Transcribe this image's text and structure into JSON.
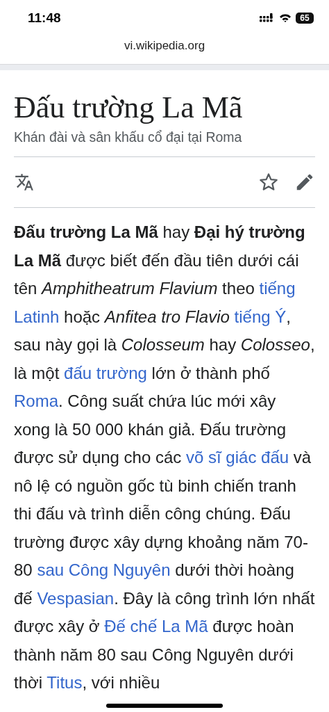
{
  "status_bar": {
    "time": "11:48",
    "battery": "65"
  },
  "address_bar": {
    "url": "vi.wikipedia.org"
  },
  "article": {
    "title": "Đấu trường La Mã",
    "subtitle": "Khán đài và sân khấu cổ đại tại Roma",
    "paragraph": [
      {
        "kind": "bold",
        "text": "Đấu trường La Mã"
      },
      {
        "kind": "plain",
        "text": " hay "
      },
      {
        "kind": "bold",
        "text": "Đại hý trường La Mã"
      },
      {
        "kind": "plain",
        "text": " được biết đến đầu tiên dưới cái tên "
      },
      {
        "kind": "italic",
        "text": "Amphitheatrum Flavium"
      },
      {
        "kind": "plain",
        "text": " theo "
      },
      {
        "kind": "link",
        "text": "tiếng"
      },
      {
        "kind": "link",
        "text": "Latinh"
      },
      {
        "kind": "plain",
        "text": " hoặc "
      },
      {
        "kind": "italic",
        "text": "Anfitea tro Flavio"
      },
      {
        "kind": "link",
        "text": "tiếng Ý"
      },
      {
        "kind": "plain",
        "text": ", sau này gọi là "
      },
      {
        "kind": "italic",
        "text": "Colosseum"
      },
      {
        "kind": "plain",
        "text": " hay "
      },
      {
        "kind": "italic",
        "text": "Colosseo"
      },
      {
        "kind": "plain",
        "text": ", là một "
      },
      {
        "kind": "link",
        "text": "đấu trường"
      },
      {
        "kind": "plain",
        "text": " lớn ở thành phố "
      },
      {
        "kind": "link",
        "text": "Roma"
      },
      {
        "kind": "plain",
        "text": ". Công suất chứa lúc mới xây xong là 50 000 khán giả. Đấu trường được sử dụng cho các "
      },
      {
        "kind": "link",
        "text": "võ sĩ giác"
      },
      {
        "kind": "link",
        "text": "đấu"
      },
      {
        "kind": "plain",
        "text": " và nô lệ có nguồn gốc tù binh chiến tranh thi đấu và trình diễn công chúng. Đấu trường được xây dựng khoảng năm 70-80 "
      },
      {
        "kind": "link",
        "text": "sau Công Nguyên"
      },
      {
        "kind": "plain",
        "text": " dưới thời hoàng đế "
      },
      {
        "kind": "link",
        "text": "Vespasian"
      },
      {
        "kind": "plain",
        "text": ". Đây là công trình lớn nhất được xây ở "
      },
      {
        "kind": "link",
        "text": "Đế chế"
      },
      {
        "kind": "link",
        "text": "La Mã"
      },
      {
        "kind": "plain",
        "text": " được hoàn thành năm 80 sau Công Nguyên dưới thời "
      },
      {
        "kind": "link",
        "text": "Titus"
      },
      {
        "kind": "plain",
        "text": ", với nhiều"
      }
    ]
  }
}
